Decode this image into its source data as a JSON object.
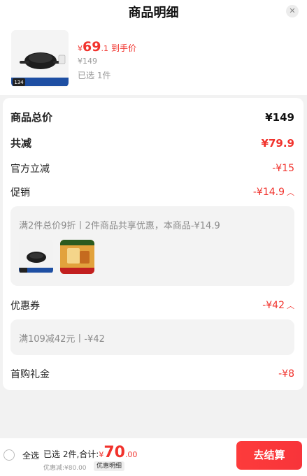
{
  "header": {
    "title": "商品明细",
    "close_icon": "close-icon"
  },
  "product": {
    "thumb_tag": "134",
    "price_symbol": "¥",
    "price_int": "69",
    "price_dec": ".1",
    "price_label": "到手价",
    "original_price": "¥149",
    "selected_text": "已选 1件"
  },
  "details": {
    "total_label": "商品总价",
    "total_value": "¥149",
    "reduce_label": "共减",
    "reduce_value": "¥79.9",
    "official_label": "官方立减",
    "official_value": "-¥15",
    "promo_label": "促销",
    "promo_value": "-¥14.9",
    "promo_desc": "满2件总价9折丨2件商品共享优惠，本商品-¥14.9",
    "coupon_label": "优惠券",
    "coupon_value": "-¥42",
    "coupon_desc": "满109减42元丨-¥42",
    "gift_label": "首购礼金",
    "gift_value": "-¥8"
  },
  "footer": {
    "select_all": "全选",
    "selected_summary": "已选 2件,合计:",
    "total_symbol": "¥",
    "total_int": "70",
    "total_dec": ".00",
    "discount_text": "优惠减:¥80.00",
    "detail_button": "优惠明细",
    "checkout_button": "去结算"
  },
  "colors": {
    "accent": "#f1322c",
    "background": "#f2f2f2"
  }
}
